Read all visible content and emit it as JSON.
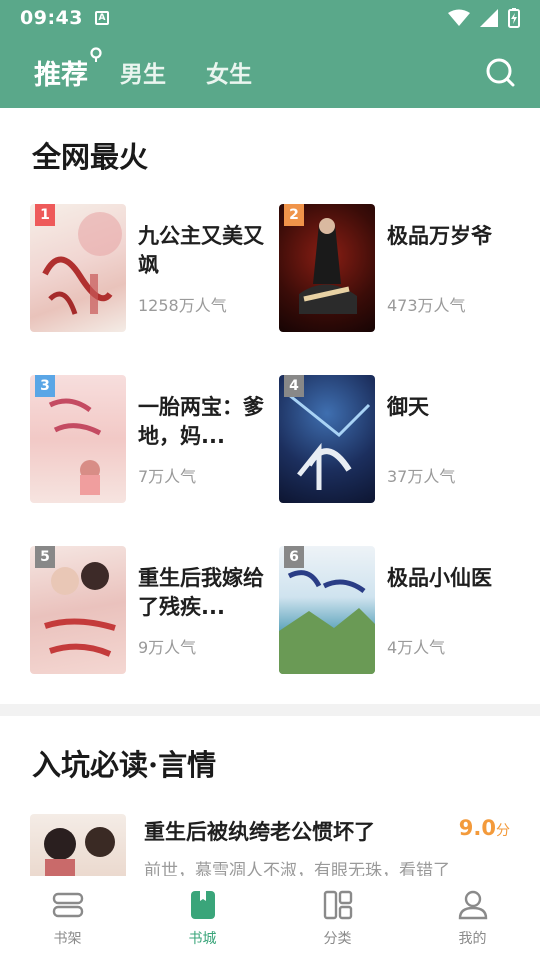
{
  "status_bar": {
    "time": "09:43",
    "notif_glyph": "A"
  },
  "header": {
    "tabs": [
      {
        "label": "推荐",
        "active": true
      },
      {
        "label": "男生",
        "active": false
      },
      {
        "label": "女生",
        "active": false
      }
    ]
  },
  "hot": {
    "title": "全网最火",
    "books": [
      {
        "rank": "1",
        "title": "九公主又美又飒",
        "popularity": "1258万人气",
        "rank_color": "#ee5a5a"
      },
      {
        "rank": "2",
        "title": "极品万岁爷",
        "popularity": "473万人气",
        "rank_color": "#f0944a"
      },
      {
        "rank": "3",
        "title": "一胎两宝：爹地，妈...",
        "popularity": "7万人气",
        "rank_color": "#5aa6e6"
      },
      {
        "rank": "4",
        "title": "御天",
        "popularity": "37万人气",
        "rank_color": "#888888"
      },
      {
        "rank": "5",
        "title": "重生后我嫁给了残疾...",
        "popularity": "9万人气",
        "rank_color": "#888888"
      },
      {
        "rank": "6",
        "title": "极品小仙医",
        "popularity": "4万人气",
        "rank_color": "#888888"
      }
    ]
  },
  "romance": {
    "title": "入坑必读·言情",
    "items": [
      {
        "title": "重生后被纨绔老公惯坏了",
        "score": "9.0",
        "score_unit": "分",
        "desc": "前世，慕雪凋人不淑，有眼无珠，看错了"
      }
    ]
  },
  "bottom_nav": [
    {
      "label": "书架",
      "icon": "bookshelf-icon",
      "active": false
    },
    {
      "label": "书城",
      "icon": "bookstore-icon",
      "active": true
    },
    {
      "label": "分类",
      "icon": "category-icon",
      "active": false
    },
    {
      "label": "我的",
      "icon": "profile-icon",
      "active": false
    }
  ],
  "colors": {
    "brand": "#5aa88a",
    "active_nav": "#3aa57a",
    "score": "#f39a3b"
  }
}
